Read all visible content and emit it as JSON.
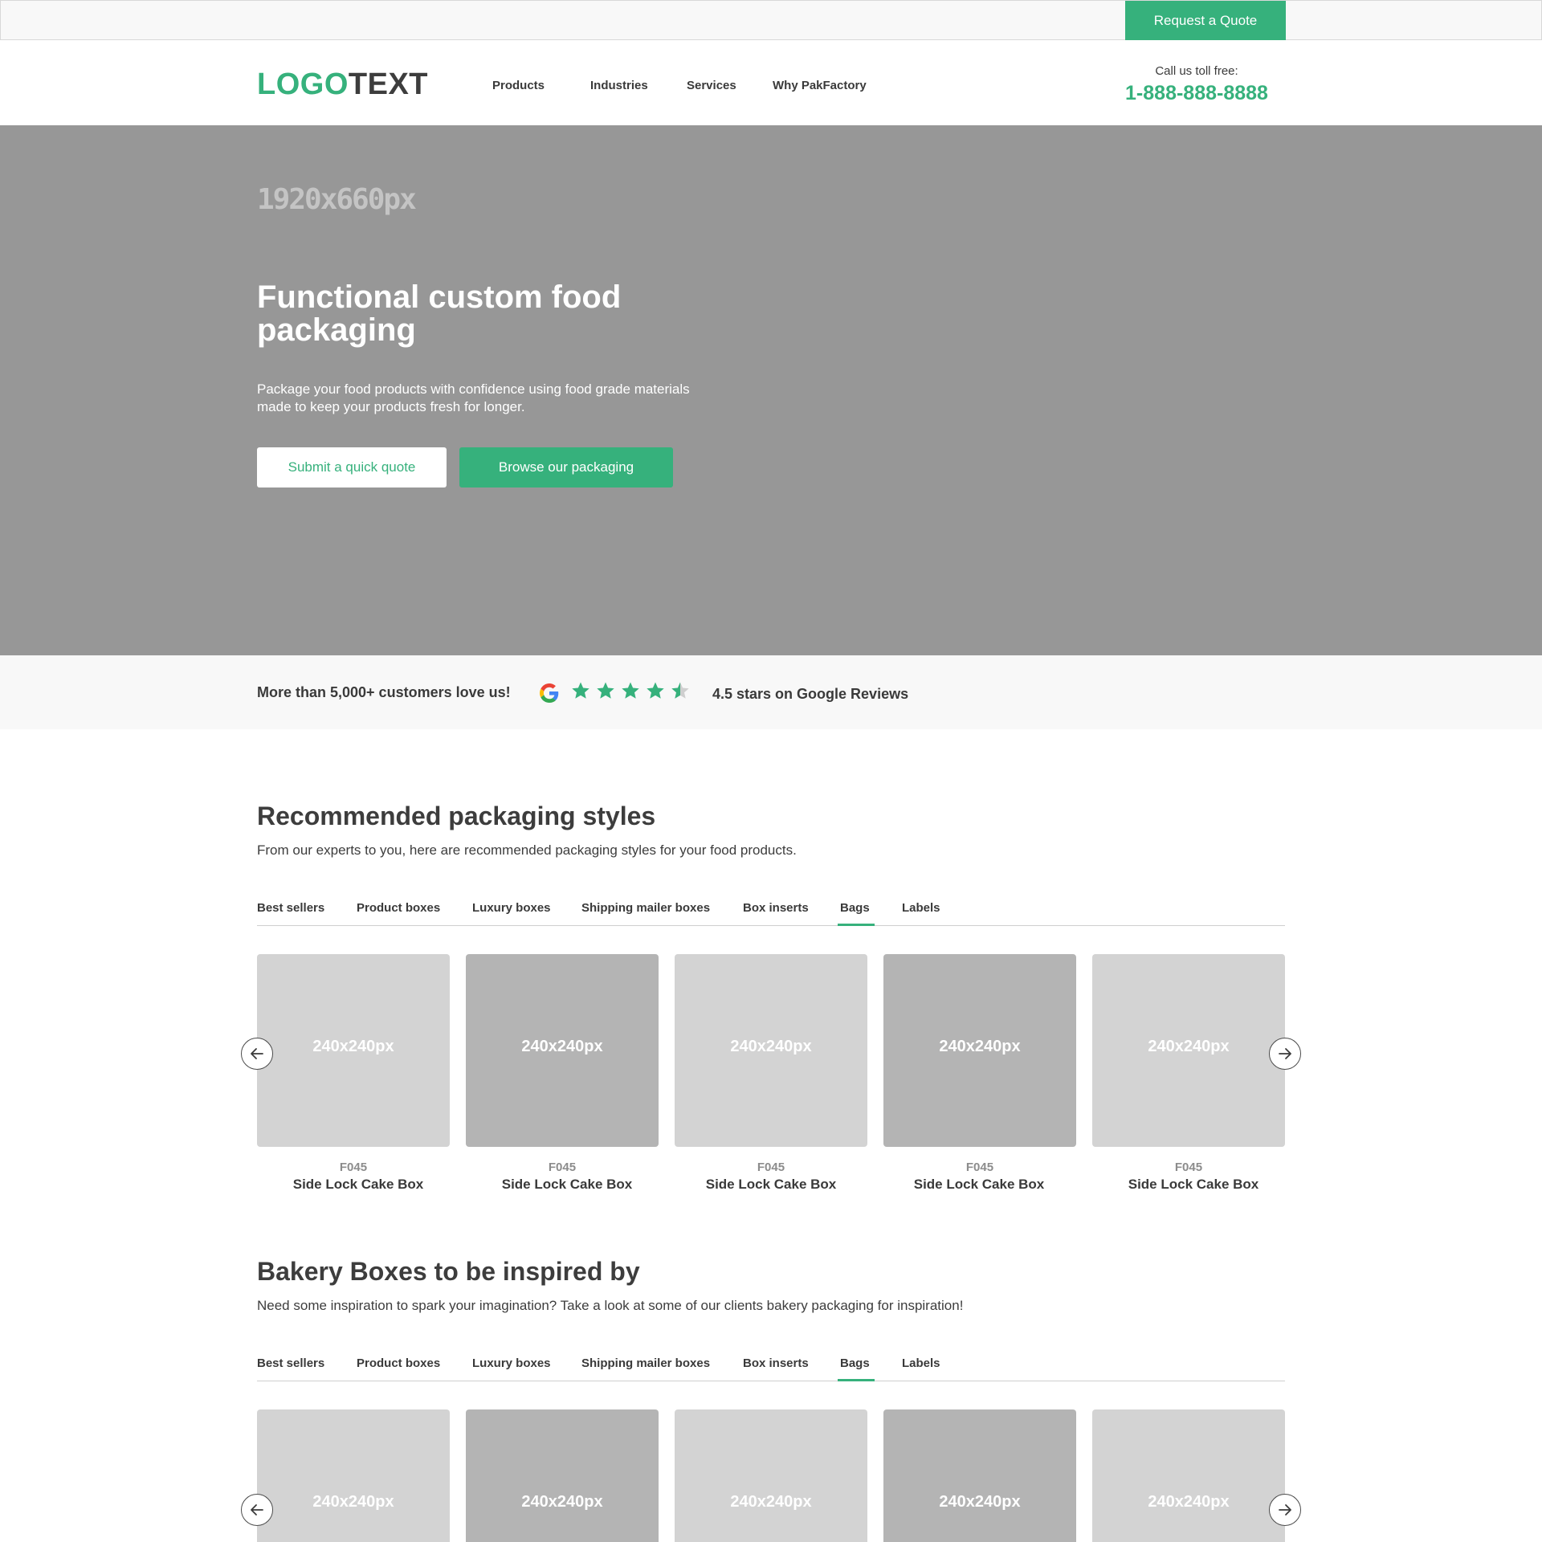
{
  "topbar": {
    "quote_label": "Request a Quote"
  },
  "header": {
    "logo_part1": "LOGO",
    "logo_part2": "TEXT",
    "nav": [
      "Products",
      "Industries",
      "Services",
      "Why PakFactory"
    ],
    "call_label": "Call us toll free:",
    "phone": "1-888-888-8888"
  },
  "hero": {
    "dimension_label": "1920x660px",
    "title": "Functional custom food packaging",
    "text": "Package your food products with confidence using food grade materials made to keep your products fresh for longer.",
    "primary_button": "Submit a quick quote",
    "secondary_button": "Browse our packaging"
  },
  "reviews": {
    "love_text": "More than 5,000+ customers love us!",
    "rating": 4.5,
    "rating_text": "4.5 stars on Google Reviews"
  },
  "section1": {
    "title": "Recommended packaging styles",
    "subtitle": "From our experts to you, here are recommended packaging styles for your food products.",
    "tabs": [
      "Best sellers",
      "Product boxes",
      "Luxury boxes",
      "Shipping mailer boxes",
      "Box inserts",
      "Bags",
      "Labels"
    ],
    "active_tab": "Bags",
    "products": [
      {
        "image_label": "240x240px",
        "code": "F045",
        "name": "Side Lock Cake Box"
      },
      {
        "image_label": "240x240px",
        "code": "F045",
        "name": "Side Lock Cake Box"
      },
      {
        "image_label": "240x240px",
        "code": "F045",
        "name": "Side Lock Cake Box"
      },
      {
        "image_label": "240x240px",
        "code": "F045",
        "name": "Side Lock Cake Box"
      },
      {
        "image_label": "240x240px",
        "code": "F045",
        "name": "Side Lock Cake Box"
      }
    ]
  },
  "section2": {
    "title": "Bakery Boxes to be inspired by",
    "subtitle": "Need some inspiration to spark your imagination? Take a look at some of our clients bakery packaging for inspiration!",
    "tabs": [
      "Best sellers",
      "Product boxes",
      "Luxury boxes",
      "Shipping mailer boxes",
      "Box inserts",
      "Bags",
      "Labels"
    ],
    "active_tab": "Bags",
    "images": [
      "240x240px",
      "240x240px",
      "240x240px",
      "240x240px",
      "240x240px"
    ]
  },
  "colors": {
    "accent": "#36b17c",
    "hero_bg": "#979797",
    "text": "#3d3d3d"
  }
}
